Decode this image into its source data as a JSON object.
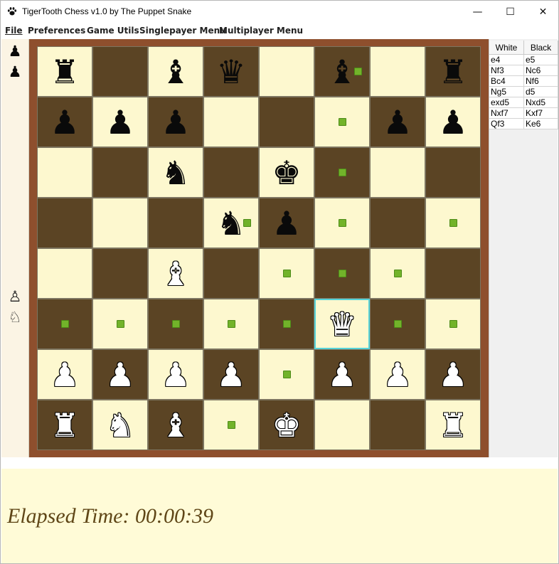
{
  "window": {
    "title": "TigerTooth Chess v1.0 by The Puppet Snake",
    "minimize_glyph": "—",
    "maximize_glyph": "☐",
    "close_glyph": "✕"
  },
  "menu": {
    "file": "File",
    "preferences": "Preferences",
    "game_utils": "Game Utils",
    "singleplayer": "Singlepayer Menu",
    "multiplayer": "Multiplayer Menu"
  },
  "captured": {
    "by_white": [
      "♟",
      "♟"
    ],
    "by_black": [
      "♙",
      "♘"
    ]
  },
  "board": {
    "rows": [
      [
        {
          "p": "♜",
          "c": "black"
        },
        {
          "p": "",
          "c": ""
        },
        {
          "p": "♝",
          "c": "black"
        },
        {
          "p": "♛",
          "c": "black"
        },
        {
          "p": "",
          "c": ""
        },
        {
          "p": "♝",
          "c": "black"
        },
        {
          "p": "",
          "c": ""
        },
        {
          "p": "♜",
          "c": "black"
        }
      ],
      [
        {
          "p": "♟",
          "c": "black"
        },
        {
          "p": "♟",
          "c": "black"
        },
        {
          "p": "♟",
          "c": "black"
        },
        {
          "p": "",
          "c": ""
        },
        {
          "p": "",
          "c": ""
        },
        {
          "p": "",
          "c": ""
        },
        {
          "p": "♟",
          "c": "black"
        },
        {
          "p": "♟",
          "c": "black"
        }
      ],
      [
        {
          "p": "",
          "c": ""
        },
        {
          "p": "",
          "c": ""
        },
        {
          "p": "♞",
          "c": "black"
        },
        {
          "p": "",
          "c": ""
        },
        {
          "p": "♚",
          "c": "black"
        },
        {
          "p": "",
          "c": ""
        },
        {
          "p": "",
          "c": ""
        },
        {
          "p": "",
          "c": ""
        }
      ],
      [
        {
          "p": "",
          "c": ""
        },
        {
          "p": "",
          "c": ""
        },
        {
          "p": "",
          "c": ""
        },
        {
          "p": "♞",
          "c": "black"
        },
        {
          "p": "♟",
          "c": "black"
        },
        {
          "p": "",
          "c": ""
        },
        {
          "p": "",
          "c": ""
        },
        {
          "p": "",
          "c": ""
        }
      ],
      [
        {
          "p": "",
          "c": ""
        },
        {
          "p": "",
          "c": ""
        },
        {
          "p": "♝",
          "c": "white"
        },
        {
          "p": "",
          "c": ""
        },
        {
          "p": "",
          "c": ""
        },
        {
          "p": "",
          "c": ""
        },
        {
          "p": "",
          "c": ""
        },
        {
          "p": "",
          "c": ""
        }
      ],
      [
        {
          "p": "",
          "c": ""
        },
        {
          "p": "",
          "c": ""
        },
        {
          "p": "",
          "c": ""
        },
        {
          "p": "",
          "c": ""
        },
        {
          "p": "",
          "c": ""
        },
        {
          "p": "♛",
          "c": "white"
        },
        {
          "p": "",
          "c": ""
        },
        {
          "p": "",
          "c": ""
        }
      ],
      [
        {
          "p": "♟",
          "c": "white"
        },
        {
          "p": "♟",
          "c": "white"
        },
        {
          "p": "♟",
          "c": "white"
        },
        {
          "p": "♟",
          "c": "white"
        },
        {
          "p": "",
          "c": ""
        },
        {
          "p": "♟",
          "c": "white"
        },
        {
          "p": "♟",
          "c": "white"
        },
        {
          "p": "♟",
          "c": "white"
        }
      ],
      [
        {
          "p": "♜",
          "c": "white"
        },
        {
          "p": "♞",
          "c": "white"
        },
        {
          "p": "♝",
          "c": "white"
        },
        {
          "p": "",
          "c": ""
        },
        {
          "p": "♚",
          "c": "white"
        },
        {
          "p": "",
          "c": ""
        },
        {
          "p": "",
          "c": ""
        },
        {
          "p": "♜",
          "c": "white"
        }
      ]
    ],
    "selected": "f3",
    "move_targets": [
      "f8",
      "f7",
      "f6",
      "d5",
      "f5",
      "h5",
      "e4",
      "f4",
      "g4",
      "a3",
      "b3",
      "c3",
      "d3",
      "e3",
      "g3",
      "h3",
      "e2",
      "d1"
    ]
  },
  "moves": {
    "header_white": "White",
    "header_black": "Black",
    "list": [
      {
        "white": "e4",
        "black": "e5"
      },
      {
        "white": "Nf3",
        "black": "Nc6"
      },
      {
        "white": "Bc4",
        "black": "Nf6"
      },
      {
        "white": "Ng5",
        "black": "d5"
      },
      {
        "white": "exd5",
        "black": "Nxd5"
      },
      {
        "white": "Nxf7",
        "black": "Kxf7"
      },
      {
        "white": "Qf3",
        "black": "Ke6"
      }
    ]
  },
  "timer": {
    "text": "Elapsed Time: 00:00:39"
  },
  "colors": {
    "light_square": "#fdf8cf",
    "dark_square": "#5b4424",
    "frame": "#8e4f2d",
    "move_dot": "#72b32a",
    "selection": "#55d3d9",
    "timer_text": "#5f4617"
  }
}
